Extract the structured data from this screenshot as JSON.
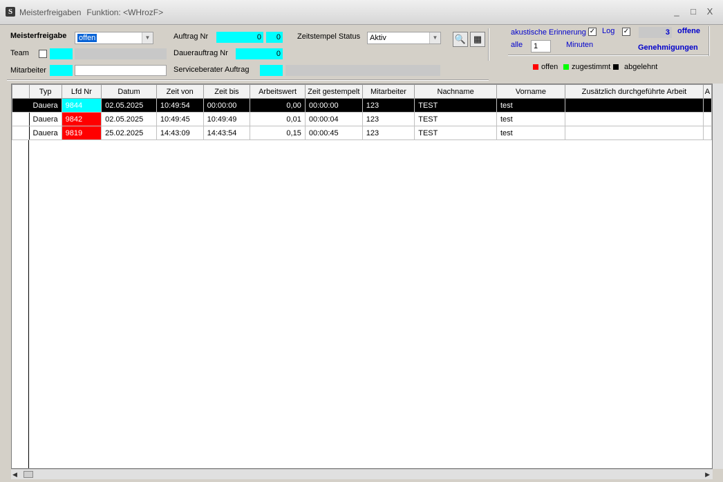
{
  "window": {
    "app_icon": "S",
    "title": "Meisterfreigaben",
    "function_label": "Funktion: <WHrozF>",
    "minimize_icon": "_",
    "maximize_icon": "□",
    "close_icon": "X"
  },
  "form": {
    "meisterfreigabe_label": "Meisterfreigabe",
    "meisterfreigabe_value": "offen",
    "team_label": "Team",
    "mitarbeiter_label": "Mitarbeiter",
    "auftrag_nr_label": "Auftrag Nr",
    "auftrag_nr_value": "0",
    "auftrag_nr_value2": "0",
    "dauerauftrag_nr_label": "Dauerauftrag Nr",
    "dauerauftrag_nr_value": "0",
    "serviceberater_label": "Serviceberater Auftrag",
    "zeitstempel_status_label": "Zeitstempel Status",
    "zeitstempel_status_value": "Aktiv",
    "search_icon": "🔍",
    "calc_icon": "▦"
  },
  "reminder": {
    "akustische_label": "akustische Erinnerung",
    "akustische_checked": "✓",
    "log_label": "Log",
    "log_checked": "✓",
    "count": "3",
    "offene_label": "offene",
    "genehmigungen_label": "Genehmigungen",
    "alle_label": "alle",
    "interval_value": "1",
    "minuten_label": "Minuten"
  },
  "legend": {
    "offen_label": "offen",
    "offen_color": "#ff0000",
    "zugestimmt_label": "zugestimmt",
    "zugestimmt_color": "#00ff00",
    "abgelehnt_label": "abgelehnt",
    "abgelehnt_color": "#000000"
  },
  "table": {
    "columns": [
      "Typ",
      "Lfd Nr",
      "Datum",
      "Zeit von",
      "Zeit bis",
      "Arbeitswert",
      "Zeit gestempelt",
      "Mitarbeiter",
      "Nachname",
      "Vorname",
      "Zusätzlich durchgeführte Arbeit",
      "A"
    ],
    "rows": [
      {
        "typ": "Dauera",
        "lfd": "9844",
        "datum": "02.05.2025",
        "von": "10:49:54",
        "bis": "00:00:00",
        "wert": "0,00",
        "gestempelt": "00:00:00",
        "mitarbeiter": "123",
        "nachname": "TEST",
        "vorname": "test",
        "zusatz": ""
      },
      {
        "typ": "Dauera",
        "lfd": "9842",
        "datum": "02.05.2025",
        "von": "10:49:45",
        "bis": "10:49:49",
        "wert": "0,01",
        "gestempelt": "00:00:04",
        "mitarbeiter": "123",
        "nachname": "TEST",
        "vorname": "test",
        "zusatz": ""
      },
      {
        "typ": "Dauera",
        "lfd": "9819",
        "datum": "25.02.2025",
        "von": "14:43:09",
        "bis": "14:43:54",
        "wert": "0,15",
        "gestempelt": "00:00:45",
        "mitarbeiter": "123",
        "nachname": "TEST",
        "vorname": "test",
        "zusatz": ""
      }
    ]
  },
  "scroll": {
    "left_arrow": "◀",
    "right_arrow": "▶"
  }
}
